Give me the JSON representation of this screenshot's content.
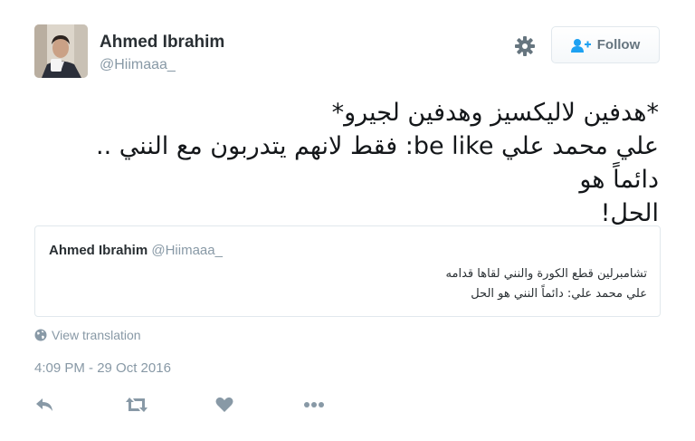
{
  "user": {
    "name": "Ahmed Ibrahim",
    "handle": "@Hiimaaa_"
  },
  "header": {
    "settings_icon": "gear-icon",
    "follow_label": "Follow",
    "follow_icon": "add-user-icon"
  },
  "tweet": {
    "lines": [
      "*هدفين لاليكسيز وهدفين لجيرو*",
      "علي محمد علي be like: فقط لانهم يتدربون مع النني .. دائماً هو",
      "الحل!"
    ]
  },
  "quoted": {
    "name": "Ahmed Ibrahim",
    "handle": "@Hiimaaa_",
    "lines": [
      "تشامبرلين قطع الكورة والنني لقاها قدامه",
      "علي محمد علي: دائماً النني هو الحل"
    ]
  },
  "translate": {
    "label": "View translation",
    "icon": "globe-icon"
  },
  "timestamp": "4:09 PM - 29 Oct 2016",
  "actions": [
    {
      "name": "reply-icon"
    },
    {
      "name": "retweet-icon"
    },
    {
      "name": "like-icon"
    },
    {
      "name": "more-icon"
    }
  ],
  "colors": {
    "text": "#14171a",
    "muted": "#8899a6",
    "follow_icon": "#1da1f2",
    "border": "#e1e8ed"
  }
}
